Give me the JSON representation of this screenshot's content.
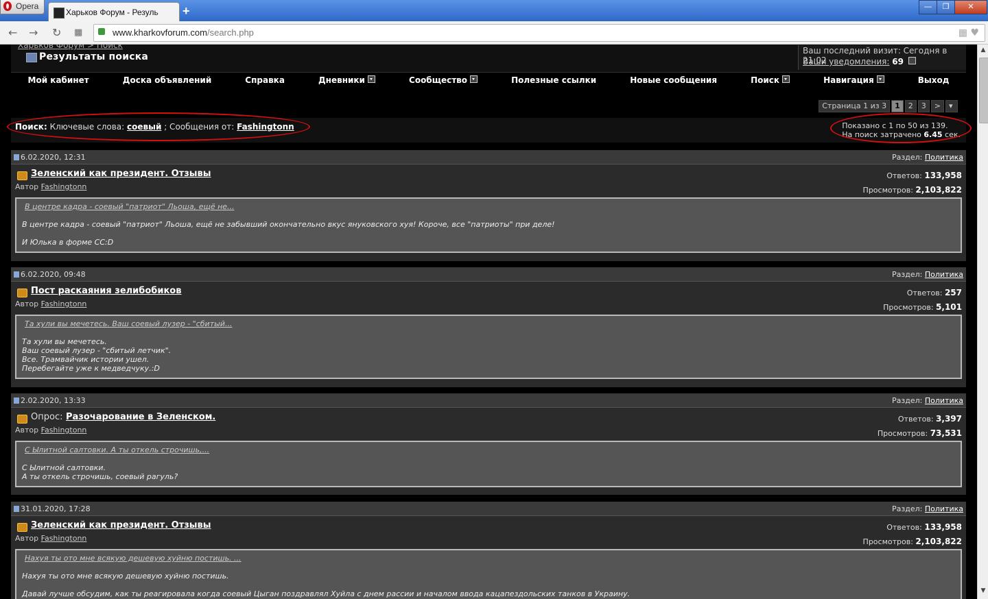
{
  "browser": {
    "app_name": "Opera",
    "tab_title": "Харьков Форум - Резуль",
    "url_host": "www.kharkovforum.com",
    "url_path": "/search.php",
    "new_tab": "+",
    "win_min": "—",
    "win_max": "❐",
    "win_close": "✕"
  },
  "breadcrumb": {
    "top": "Харьков Форум > Поиск",
    "title": "Результаты поиска"
  },
  "lastvisit": {
    "line1": "Ваш последний визит: Сегодня в 21:02",
    "notif_label": "Ваши уведомления:",
    "notif_count": "69"
  },
  "menu": [
    "Мой кабинет",
    "Доска объявлений",
    "Справка",
    "Дневники",
    "Сообщество",
    "Полезные ссылки",
    "Новые сообщения",
    "Поиск",
    "Навигация",
    "Выход"
  ],
  "pager": {
    "label": "Страница 1 из 3",
    "p1": "1",
    "p2": "2",
    "p3": "3",
    "next": ">"
  },
  "search": {
    "prefix": "Поиск:",
    "kw_label": "Ключевые слова:",
    "kw": "соевый",
    "sep": "; Сообщения от:",
    "author": "Fashingtonn",
    "shown": "Показано с 1 по 50 из 139.",
    "time_label": "На поиск затрачено",
    "time_val": "6.45",
    "time_unit": "сек."
  },
  "labels": {
    "section": "Раздел:",
    "author": "Автор",
    "replies": "Ответов:",
    "views": "Просмотров:"
  },
  "posts": [
    {
      "date": "6.02.2020, 12:31",
      "section": "Политика",
      "prefix": "",
      "title": "Зеленский как президент. Отзывы",
      "author": "Fashingtonn",
      "replies": "133,958",
      "views": "2,103,822",
      "preview_link": "В центре кадра - соевый \"патриот\" Льоша, ещё не...",
      "preview_text": "В центре кадра - соевый \"патриот\" Льоша, ещё не забывший окончательно вкус януковского хуя! Короче, все \"патриоты\" при деле!\n\nИ Юлька в форме СС:D"
    },
    {
      "date": "6.02.2020, 09:48",
      "section": "Политика",
      "prefix": "",
      "title": "Пост раскаяния зелибобиков",
      "author": "Fashingtonn",
      "replies": "257",
      "views": "5,101",
      "preview_link": "Та хули вы мечетесь. Ваш соевый лузер - \"сбитый...",
      "preview_text": "Та хули вы мечетесь.\nВаш соевый лузер - \"сбитый летчик\".\nВсе. Трамвайчик истории ушел.\nПеребегайте уже к медведчуку.:D"
    },
    {
      "date": "2.02.2020, 13:33",
      "section": "Политика",
      "prefix": "Опрос:",
      "title": "Разочарование в Зеленском.",
      "author": "Fashingtonn",
      "replies": "3,397",
      "views": "73,531",
      "preview_link": "С Ылитной салтовки. А ты откель строчишь,...",
      "preview_text": "С Ылитной салтовки.\nА ты откель строчишь, соевый рагуль?"
    },
    {
      "date": "31.01.2020, 17:28",
      "section": "Политика",
      "prefix": "",
      "title": "Зеленский как президент. Отзывы",
      "author": "Fashingtonn",
      "replies": "133,958",
      "views": "2,103,822",
      "preview_link": "Нахуя ты ото мне всякую дешевую хуйню постишь. ...",
      "preview_text": "Нахуя ты ото мне всякую дешевую хуйню постишь.\n\nДавай лучше обсудим, как ты реагировала когда соевый Цыган поздравлял Хуйла с днем рассии и началом ввода кацапездольских танков в Украину."
    }
  ]
}
